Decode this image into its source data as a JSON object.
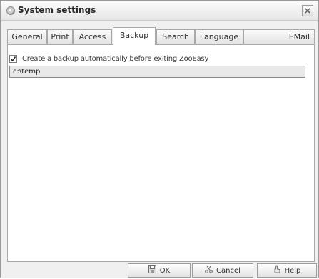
{
  "window": {
    "title": "System settings"
  },
  "tabs": [
    {
      "label": "General"
    },
    {
      "label": "Print"
    },
    {
      "label": "Access"
    },
    {
      "label": "Backup",
      "active": true
    },
    {
      "label": "Search"
    },
    {
      "label": "Language"
    },
    {
      "label": "EMail"
    }
  ],
  "backup": {
    "auto_backup_label": "Create a backup automatically before exiting ZooEasy",
    "auto_backup_checked": true,
    "backup_path": "c:\\temp"
  },
  "buttons": {
    "ok_label": "OK",
    "cancel_label": "Cancel",
    "help_label": "Help"
  },
  "icons": {
    "app": "zooeasy-app-icon",
    "close": "close-icon",
    "ok": "save-disk-icon",
    "cancel": "scissors-icon",
    "help": "help-hand-icon"
  }
}
